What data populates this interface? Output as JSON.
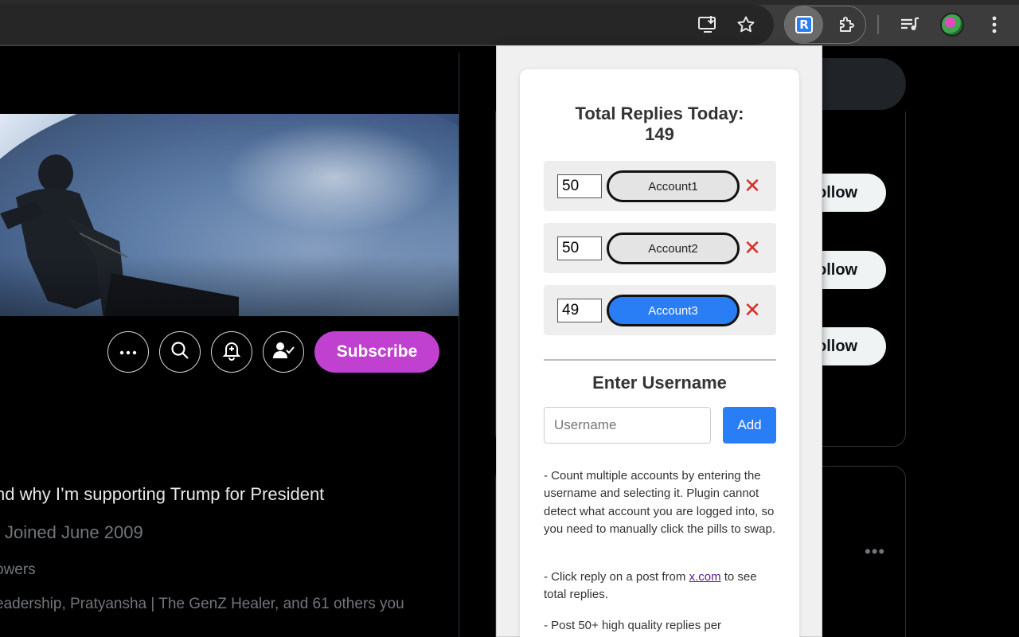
{
  "extension": {
    "badge_letter": "R",
    "title": "Total Replies Today:",
    "total": "149",
    "accounts": [
      {
        "count": "50",
        "name": "Account1",
        "active": false,
        "remove_glyph": "✕"
      },
      {
        "count": "50",
        "name": "Account2",
        "active": false,
        "remove_glyph": "✕"
      },
      {
        "count": "49",
        "name": "Account3",
        "active": true,
        "remove_glyph": "✕"
      }
    ],
    "enter_title": "Enter Username",
    "username_placeholder": "Username",
    "username_value": "",
    "add_label": "Add",
    "help_1": "- Count multiple accounts by entering the username and selecting it. Plugin cannot detect what account you are logged into, so you need to manually click the pills to swap.",
    "help_2_prefix": "- Click reply on a post from ",
    "help_2_link": "x.com",
    "help_2_suffix": " to see total replies.",
    "help_3": "- Post 50+ high quality replies per",
    "accent_color": "#2a7ef5",
    "remove_color": "#d6302a"
  },
  "profile": {
    "subscribe_label": "Subscribe",
    "tagline": "nd why I’m supporting Trump for President",
    "joined": "Joined June 2009",
    "followers": "owers",
    "followed_by": "eadership, Pratyansha | The GenZ Healer, and 61 others you",
    "subscribe_color": "#c040d0"
  },
  "sidebar": {
    "follow_labels": [
      "ollow",
      "ollow",
      "ollow"
    ],
    "more_glyph": "•••"
  },
  "icons": {
    "toolbar": [
      "install-app-icon",
      "bookmark-star-icon",
      "extension-r-icon",
      "extensions-puzzle-icon",
      "media-queue-icon",
      "profile-avatar",
      "chrome-menu-icon"
    ],
    "profile_actions": [
      "more-icon",
      "search-icon",
      "notification-bell-icon",
      "following-check-icon"
    ]
  }
}
